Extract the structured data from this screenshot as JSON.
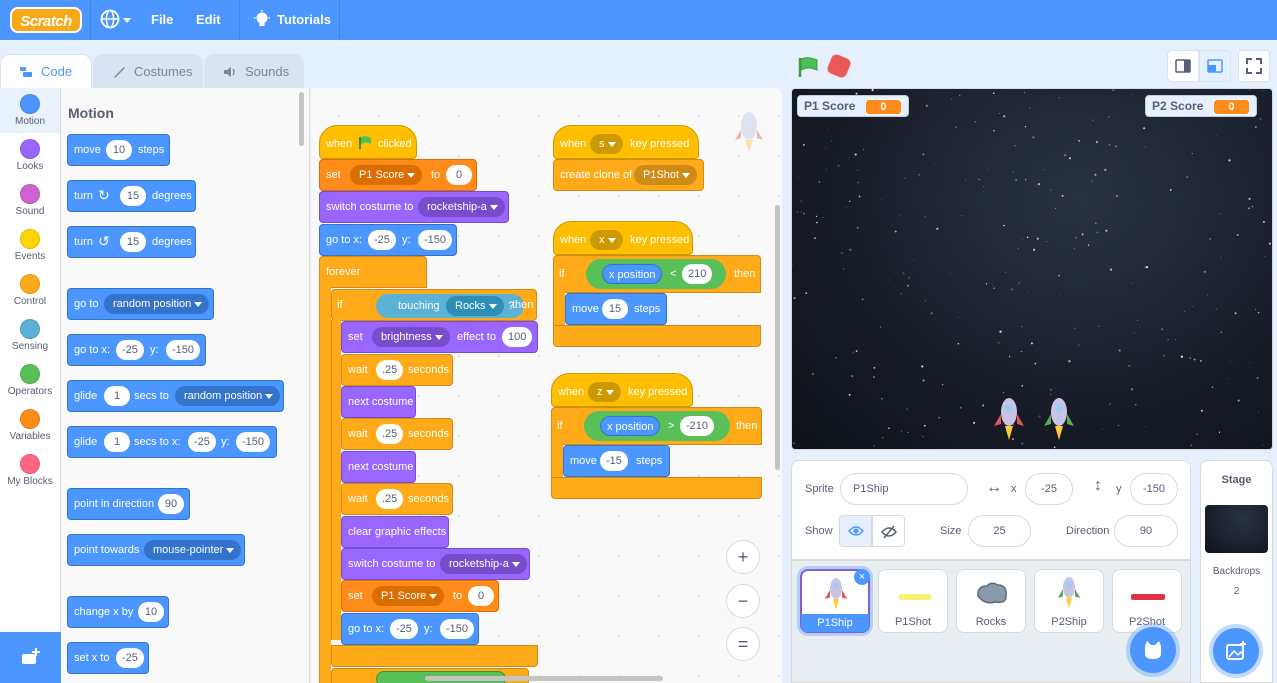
{
  "menu": {
    "logo": "Scratch",
    "file": "File",
    "edit": "Edit",
    "tutorials": "Tutorials"
  },
  "tabs": [
    {
      "label": "Code",
      "icon": "code-icon"
    },
    {
      "label": "Costumes",
      "icon": "brush-icon"
    },
    {
      "label": "Sounds",
      "icon": "speaker-icon"
    }
  ],
  "categories": [
    {
      "label": "Motion",
      "color": "#4C97FF"
    },
    {
      "label": "Looks",
      "color": "#9966FF"
    },
    {
      "label": "Sound",
      "color": "#CF63CF"
    },
    {
      "label": "Events",
      "color": "#FFD500"
    },
    {
      "label": "Control",
      "color": "#FFAB19"
    },
    {
      "label": "Sensing",
      "color": "#5CB1D6"
    },
    {
      "label": "Operators",
      "color": "#59C059"
    },
    {
      "label": "Variables",
      "color": "#FF8C1A"
    },
    {
      "label": "My Blocks",
      "color": "#FF6680"
    }
  ],
  "palette": {
    "title": "Motion",
    "move": {
      "a": "move",
      "n": "10",
      "b": "steps"
    },
    "turn_right": {
      "a": "turn",
      "n": "15",
      "b": "degrees"
    },
    "turn_left": {
      "a": "turn",
      "n": "15",
      "b": "degrees"
    },
    "goto": {
      "a": "go to",
      "d": "random position"
    },
    "gotoxy": {
      "a": "go to x:",
      "x": "-25",
      "b": "y:",
      "y": "-150"
    },
    "glide": {
      "a": "glide",
      "n": "1",
      "b": "secs to",
      "d": "random position"
    },
    "glidexy": {
      "a": "glide",
      "n": "1",
      "b": "secs to x:",
      "x": "-25",
      "c": "y:",
      "y": "-150"
    },
    "point_dir": {
      "a": "point in direction",
      "n": "90"
    },
    "point_towards": {
      "a": "point towards",
      "d": "mouse-pointer"
    },
    "change_x": {
      "a": "change x by",
      "n": "10"
    },
    "set_x": {
      "a": "set x to",
      "n": "-25"
    }
  },
  "script1": {
    "when_a": "when",
    "when_b": "clicked",
    "set1": {
      "a": "set",
      "d": "P1 Score",
      "b": "to",
      "n": "0"
    },
    "switch1": {
      "a": "switch costume to",
      "d": "rocketship-a"
    },
    "goto1": {
      "a": "go to x:",
      "x": "-25",
      "b": "y:",
      "y": "-150"
    },
    "forever": "forever",
    "if": "if",
    "touching": "touching",
    "touching_d": "Rocks",
    "q": "?",
    "then": "then",
    "effect": {
      "a": "set",
      "d": "brightness",
      "b": "effect to",
      "n": "100"
    },
    "wait1": {
      "a": "wait",
      "n": ".25",
      "b": "seconds"
    },
    "next1": "next costume",
    "wait2": {
      "a": "wait",
      "n": ".25",
      "b": "seconds"
    },
    "next2": "next costume",
    "wait3": {
      "a": "wait",
      "n": ".25",
      "b": "seconds"
    },
    "clear": "clear graphic effects",
    "switch2": {
      "a": "switch costume to",
      "d": "rocketship-a"
    },
    "set2": {
      "a": "set",
      "d": "P1 Score",
      "b": "to",
      "n": "0"
    },
    "goto2": {
      "a": "go to x:",
      "x": "-25",
      "b": "y:",
      "y": "-150"
    }
  },
  "script2": {
    "when": "when",
    "key": "s",
    "pressed": "key pressed",
    "clone": "create clone of",
    "clone_d": "P1Shot"
  },
  "script3": {
    "when": "when",
    "key": "x",
    "pressed": "key pressed",
    "if": "if",
    "xpos": "x position",
    "op": "<",
    "n": "210",
    "then": "then",
    "move": "move",
    "m": "15",
    "steps": "steps"
  },
  "script4": {
    "when": "when",
    "key": "z",
    "pressed": "key pressed",
    "if": "if",
    "xpos": "x position",
    "op": ">",
    "n": "-210",
    "then": "then",
    "move": "move",
    "m": "-15",
    "steps": "steps"
  },
  "zoom": {
    "in": "+",
    "out": "−",
    "reset": "="
  },
  "stage": {
    "monitors": [
      {
        "label": "P1 Score",
        "value": "0"
      },
      {
        "label": "P2 Score",
        "value": "0"
      }
    ]
  },
  "sprite_info": {
    "sprite_label": "Sprite",
    "sprite_name": "P1Ship",
    "x_label": "x",
    "x": "-25",
    "y_label": "y",
    "y": "-150",
    "show_label": "Show",
    "size_label": "Size",
    "size": "25",
    "direction_label": "Direction",
    "direction": "90"
  },
  "sprites": [
    {
      "name": "P1Ship"
    },
    {
      "name": "P1Shot"
    },
    {
      "name": "Rocks"
    },
    {
      "name": "P2Ship"
    },
    {
      "name": "P2Shot"
    }
  ],
  "stage_pane": {
    "title": "Stage",
    "backdrops_label": "Backdrops",
    "backdrops_count": "2"
  }
}
